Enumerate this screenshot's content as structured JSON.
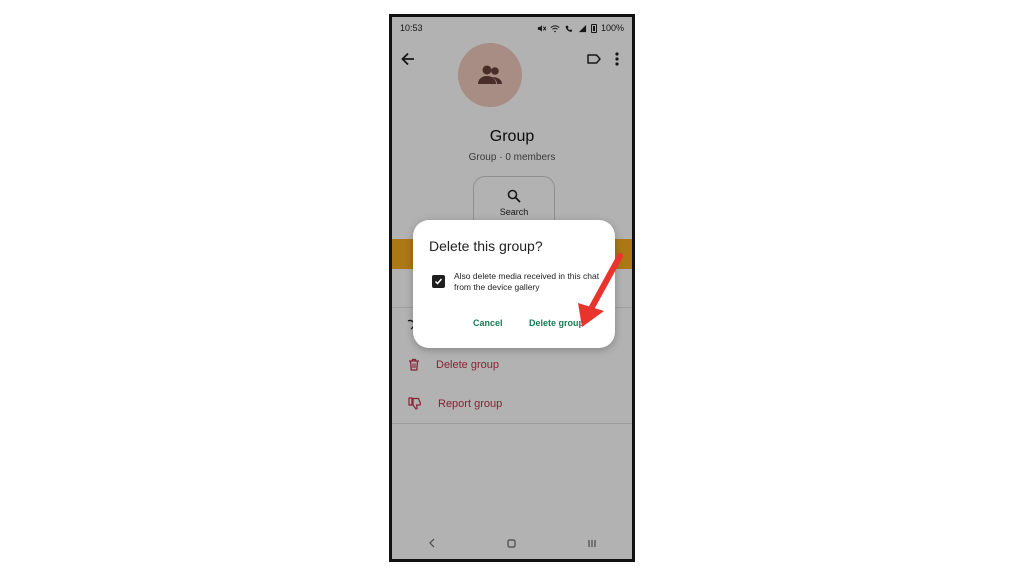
{
  "status_bar": {
    "time": "10:53",
    "battery": "100%"
  },
  "group": {
    "title": "Group",
    "subtitle": "Group · 0 members"
  },
  "search": {
    "label": "Search"
  },
  "actions": [
    {
      "label": "Delete group",
      "icon": "trash-icon"
    },
    {
      "label": "Report group",
      "icon": "thumbs-down-icon"
    }
  ],
  "dialog": {
    "title": "Delete this group?",
    "checkbox_label": "Also delete media received in this chat from the device gallery",
    "checkbox_checked": true,
    "cancel_label": "Cancel",
    "confirm_label": "Delete group"
  },
  "colors": {
    "accent": "#1a7a57",
    "danger": "#c0334d",
    "banner": "#f5ac1f",
    "avatar_bg": "#f0cbbd",
    "annotation_arrow": "#e8342c"
  }
}
